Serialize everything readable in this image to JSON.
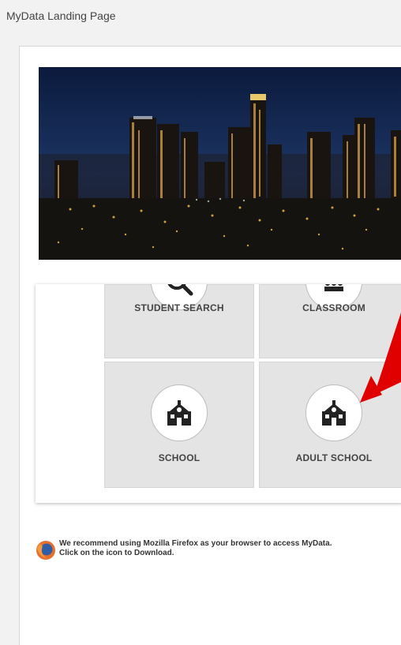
{
  "page": {
    "title": "MyData Landing Page"
  },
  "tiles": [
    {
      "label": "STUDENT SEARCH",
      "icon": "magnifier-student-icon"
    },
    {
      "label": "CLASSROOM",
      "icon": "classroom-icon"
    },
    {
      "label": "SCHOOL",
      "icon": "school-house-icon"
    },
    {
      "label": "ADULT SCHOOL",
      "icon": "school-house-icon"
    }
  ],
  "footer": {
    "line1": "We recommend using Mozilla Firefox as your browser to access MyData.",
    "line2": "Click on the icon to Download.",
    "icon": "firefox-icon"
  },
  "colors": {
    "tile_bg": "#e4e4e4",
    "annotation_arrow": "#e00000",
    "banner_sky": "#0a1530"
  }
}
